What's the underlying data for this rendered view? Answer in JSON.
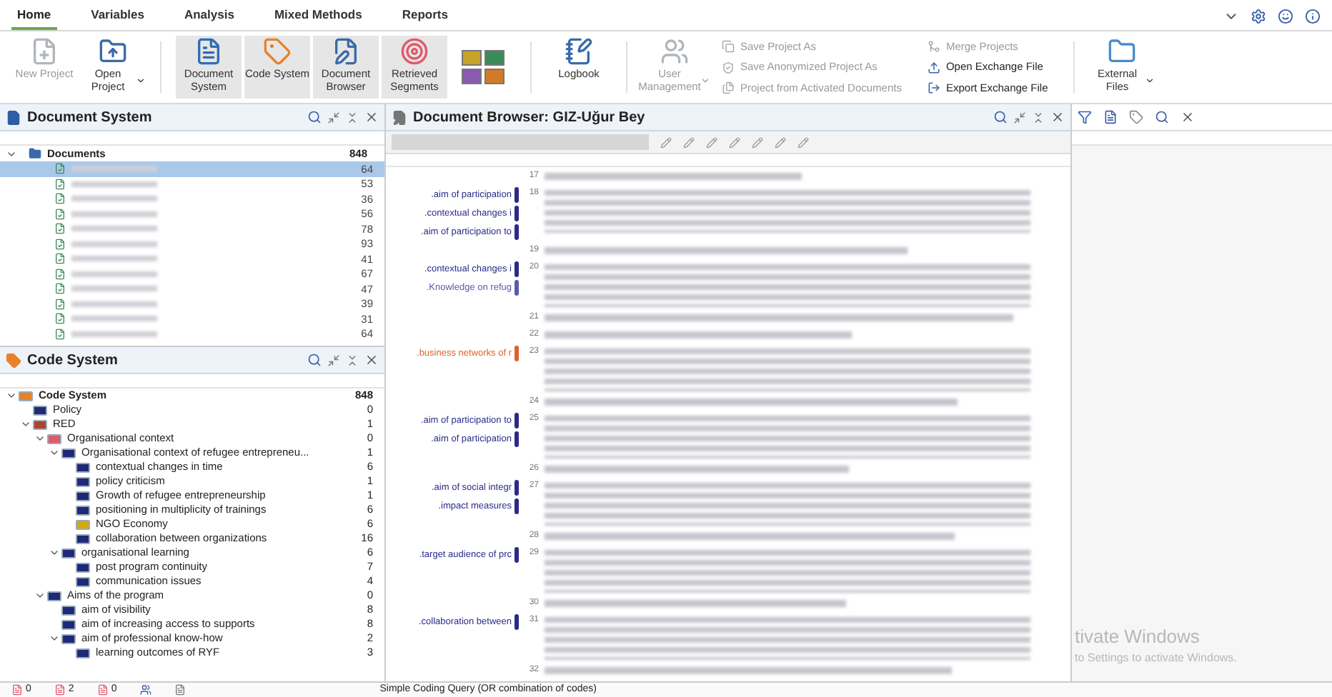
{
  "ribbon_tabs": [
    {
      "label": "Home",
      "selected": true
    },
    {
      "label": "Variables",
      "selected": false
    },
    {
      "label": "Analysis",
      "selected": false
    },
    {
      "label": "Mixed Methods",
      "selected": false
    },
    {
      "label": "Reports",
      "selected": false
    }
  ],
  "ribbon_items": [
    {
      "kind": "large",
      "label": "New Project",
      "disabled": true,
      "on": false,
      "dropdown": false
    },
    {
      "kind": "large",
      "label": "Open Project",
      "disabled": false,
      "on": false,
      "dropdown": true
    },
    {
      "kind": "divider"
    },
    {
      "kind": "large",
      "label": "Document System",
      "disabled": false,
      "on": true,
      "dropdown": false
    },
    {
      "kind": "large",
      "label": "Code System",
      "disabled": false,
      "on": true,
      "dropdown": false
    },
    {
      "kind": "large",
      "label": "Document Browser",
      "disabled": false,
      "on": true,
      "dropdown": false
    },
    {
      "kind": "large",
      "label": "Retrieved Segments",
      "disabled": false,
      "on": true,
      "dropdown": false
    },
    {
      "kind": "layout"
    },
    {
      "kind": "divider"
    },
    {
      "kind": "large",
      "label": "Logbook",
      "disabled": false,
      "on": false,
      "dropdown": false
    },
    {
      "kind": "divider"
    },
    {
      "kind": "large",
      "label": "User Management",
      "disabled": true,
      "on": false,
      "dropdown": true
    },
    {
      "kind": "small_column",
      "items": [
        {
          "label": "Save Project As",
          "disabled": true
        },
        {
          "label": "Save Anonymized Project As",
          "disabled": true
        },
        {
          "label": "Project from Activated Documents",
          "disabled": true
        }
      ]
    },
    {
      "kind": "small_column",
      "items": [
        {
          "label": "Merge Projects",
          "disabled": true
        },
        {
          "label": "Open Exchange File",
          "disabled": false
        },
        {
          "label": "Export Exchange File",
          "disabled": false
        }
      ]
    },
    {
      "kind": "divider"
    },
    {
      "kind": "large",
      "label": "External Files",
      "disabled": false,
      "on": false,
      "dropdown": true
    }
  ],
  "document_system": {
    "title": "Document System",
    "root": {
      "label": "Documents",
      "count": "848",
      "expanded": true
    },
    "documents": [
      {
        "count": "64",
        "selected": true
      },
      {
        "count": "53",
        "selected": false
      },
      {
        "count": "36",
        "selected": false
      },
      {
        "count": "56",
        "selected": false
      },
      {
        "count": "78",
        "selected": false
      },
      {
        "count": "93",
        "selected": false
      },
      {
        "count": "41",
        "selected": false
      },
      {
        "count": "67",
        "selected": false
      },
      {
        "count": "47",
        "selected": false
      },
      {
        "count": "39",
        "selected": false
      },
      {
        "count": "31",
        "selected": false
      },
      {
        "count": "64",
        "selected": false
      }
    ]
  },
  "code_system": {
    "title": "Code System",
    "tree": [
      {
        "label": "Code System",
        "count": "848",
        "expanded": true,
        "color": "#e8822a",
        "children": [
          {
            "label": "Policy",
            "count": "0",
            "color": "#1e2a78"
          },
          {
            "label": "RED",
            "count": "1",
            "expanded": true,
            "color": "#b0442a",
            "children": [
              {
                "label": "Organisational context",
                "count": "0",
                "expanded": true,
                "color": "#e05a6a",
                "children": [
                  {
                    "label": "Organisational context of refugee entrepreneu...",
                    "count": "1",
                    "expanded": true,
                    "color": "#1e2a78",
                    "children": [
                      {
                        "label": "contextual changes in time",
                        "count": "6",
                        "color": "#1e2a78"
                      },
                      {
                        "label": "policy criticism",
                        "count": "1",
                        "color": "#1e2a78"
                      },
                      {
                        "label": "Growth of refugee entrepreneurship",
                        "count": "1",
                        "color": "#1e2a78"
                      },
                      {
                        "label": "positioning in multiplicity of trainings",
                        "count": "6",
                        "color": "#1e2a78"
                      },
                      {
                        "label": "NGO Economy",
                        "count": "6",
                        "color": "#d4a90a"
                      },
                      {
                        "label": "collaboration between organizations",
                        "count": "16",
                        "color": "#1e2a78"
                      }
                    ]
                  },
                  {
                    "label": "organisational learning",
                    "count": "6",
                    "expanded": true,
                    "color": "#1e2a78",
                    "children": [
                      {
                        "label": "post program continuity",
                        "count": "7",
                        "color": "#1e2a78"
                      },
                      {
                        "label": "communication issues",
                        "count": "4",
                        "color": "#1e2a78"
                      }
                    ]
                  }
                ]
              },
              {
                "label": "Aims of the program",
                "count": "0",
                "expanded": true,
                "color": "#1e2a78",
                "children": [
                  {
                    "label": "aim of visibility",
                    "count": "8",
                    "color": "#1e2a78"
                  },
                  {
                    "label": "aim of increasing access to supports",
                    "count": "8",
                    "color": "#1e2a78"
                  },
                  {
                    "label": "aim of professional know-how",
                    "count": "2",
                    "expanded": true,
                    "color": "#1e2a78",
                    "children": [
                      {
                        "label": "learning outcomes of RYF",
                        "count": "3",
                        "color": "#1e2a78"
                      }
                    ]
                  }
                ]
              }
            ]
          }
        ]
      }
    ]
  },
  "document_browser": {
    "title": "Document Browser: GIZ-Uğur Bey",
    "paragraphs": [
      {
        "number": "17",
        "kind": "line"
      },
      {
        "number": "18",
        "kind": "block",
        "codes": [
          {
            "label": ".aim of participation",
            "color": "#2a2a8a"
          },
          {
            "label": ".contextual changes i",
            "color": "#2a2a8a"
          },
          {
            "label": ".aim of participation to",
            "color": "#2a2a8a"
          }
        ]
      },
      {
        "number": "19",
        "kind": "line"
      },
      {
        "number": "20",
        "kind": "block",
        "codes": [
          {
            "label": ".contextual changes i",
            "color": "#2a2a8a"
          },
          {
            "label": ".Knowledge on refug",
            "color": "#5a5ab0"
          }
        ]
      },
      {
        "number": "21",
        "kind": "line"
      },
      {
        "number": "22",
        "kind": "line"
      },
      {
        "number": "23",
        "kind": "block",
        "codes": [
          {
            "label": ".business networks of r",
            "color": "#e0602a"
          }
        ]
      },
      {
        "number": "24",
        "kind": "line"
      },
      {
        "number": "25",
        "kind": "block",
        "codes": [
          {
            "label": ".aim of participation to",
            "color": "#2a2a8a"
          },
          {
            "label": ".aim of participation",
            "color": "#2a2a8a"
          }
        ]
      },
      {
        "number": "26",
        "kind": "line"
      },
      {
        "number": "27",
        "kind": "block",
        "codes": [
          {
            "label": ".aim of social integr",
            "color": "#2a2a8a"
          },
          {
            "label": ".impact measures",
            "color": "#2a2a8a"
          }
        ]
      },
      {
        "number": "28",
        "kind": "line"
      },
      {
        "number": "29",
        "kind": "block",
        "codes": [
          {
            "label": ".target audience of prc",
            "color": "#2a2a8a"
          }
        ]
      },
      {
        "number": "30",
        "kind": "line"
      },
      {
        "number": "31",
        "kind": "block",
        "codes": [
          {
            "label": ".collaboration between",
            "color": "#2a2a8a"
          }
        ]
      },
      {
        "number": "32",
        "kind": "line"
      }
    ]
  },
  "os_notice": {
    "title": "tivate Windows",
    "subtitle": "to Settings to activate Windows."
  },
  "status_bar": {
    "counters": [
      "0",
      "2",
      "0"
    ],
    "query": "Simple Coding Query (OR combination of codes)"
  }
}
